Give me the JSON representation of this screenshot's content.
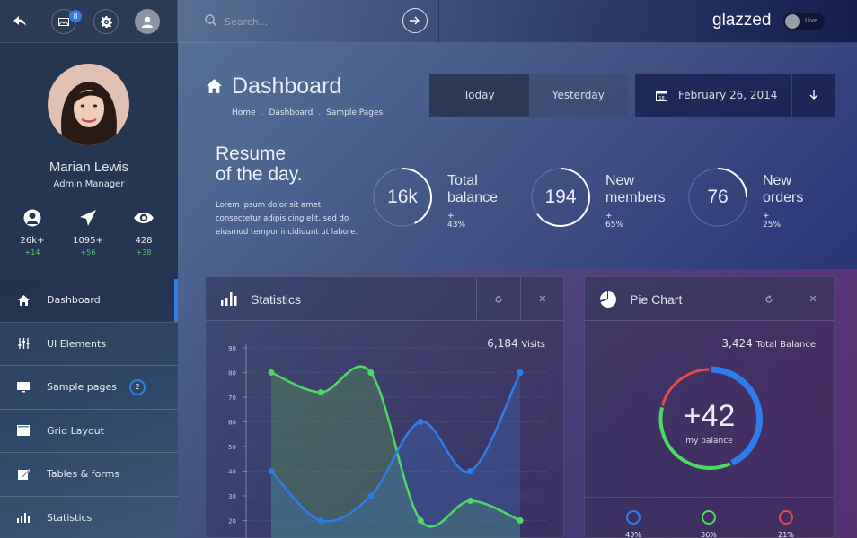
{
  "topbar": {
    "back_icon": "reply-arrow-icon",
    "mail_badge": "8",
    "search_placeholder": "Search...",
    "brand": "glazzed",
    "live_toggle_label": "Live"
  },
  "profile": {
    "name": "Marian Lewis",
    "role": "Admin Manager",
    "stats": [
      {
        "icon": "user-icon",
        "value": "26k+",
        "delta": "+14"
      },
      {
        "icon": "paper-plane-icon",
        "value": "1095+",
        "delta": "+56"
      },
      {
        "icon": "eye-icon",
        "value": "428",
        "delta": "+38"
      }
    ]
  },
  "nav": {
    "items": [
      {
        "label": "Dashboard",
        "icon": "home-icon",
        "active": true
      },
      {
        "label": "UI Elements",
        "icon": "sliders-icon"
      },
      {
        "label": "Sample pages",
        "icon": "monitor-icon",
        "badge": "2"
      },
      {
        "label": "Grid Layout",
        "icon": "window-icon"
      },
      {
        "label": "Tables & forms",
        "icon": "edit-icon"
      },
      {
        "label": "Statistics",
        "icon": "bar-chart-icon"
      }
    ]
  },
  "header": {
    "title": "Dashboard",
    "breadcrumbs": [
      "Home",
      "Dashboard",
      "Sample Pages"
    ],
    "date_buttons": [
      "Today",
      "Yesterday"
    ],
    "date": "February 26, 2014",
    "calendar_day": "18"
  },
  "resume": {
    "title_line1": "Resume",
    "title_line2": "of the day.",
    "text": "Lorem ipsum dolor sit amet, consectetur adipisicing elit, sed do eiusmod tempor incididunt ut labore."
  },
  "kpis": [
    {
      "value": "16k",
      "label1": "Total",
      "label2": "balance",
      "delta": "+ 43%",
      "progress": 0.43
    },
    {
      "value": "194",
      "label1": "New",
      "label2": "members",
      "delta": "+ 65%",
      "progress": 0.65
    },
    {
      "value": "76",
      "label1": "New",
      "label2": "orders",
      "delta": "+ 25%",
      "progress": 0.25
    }
  ],
  "statistics_panel": {
    "title": "Statistics",
    "visits_value": "6,184",
    "visits_label": "Visits"
  },
  "pie_panel": {
    "title": "Pie Chart",
    "balance_value": "3,424",
    "balance_label": "Total Balance",
    "center_value": "+42",
    "center_label": "my balance"
  },
  "chart_data": [
    {
      "type": "area",
      "title": "Statistics",
      "x": [
        1,
        2,
        3,
        4,
        5,
        6
      ],
      "ylim": [
        10,
        90
      ],
      "yticks": [
        20,
        30,
        40,
        50,
        60,
        70,
        80,
        90
      ],
      "grid": true,
      "series": [
        {
          "name": "green",
          "color": "#4cd964",
          "values": [
            80,
            72,
            80,
            20,
            28,
            20
          ]
        },
        {
          "name": "blue",
          "color": "#2f7de8",
          "values": [
            40,
            20,
            30,
            60,
            40,
            80
          ]
        }
      ]
    },
    {
      "type": "pie",
      "title": "Pie Chart",
      "slices": [
        {
          "label": "43%",
          "value": 43,
          "color": "#2f7de8"
        },
        {
          "label": "36%",
          "value": 36,
          "color": "#4cd964"
        },
        {
          "label": "21%",
          "value": 21,
          "color": "#e84b45"
        }
      ]
    }
  ]
}
